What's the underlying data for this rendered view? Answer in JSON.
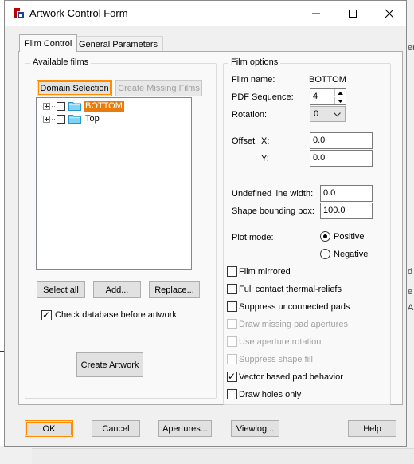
{
  "window": {
    "title": "Artwork Control Form"
  },
  "tabs": [
    {
      "label": "Film Control",
      "active": true
    },
    {
      "label": "General Parameters",
      "active": false
    }
  ],
  "available_films": {
    "group_label": "Available films",
    "domain_selection_label": "Domain Selection",
    "create_missing_label": "Create Missing Films",
    "films": [
      {
        "label": "BOTTOM",
        "selected": true,
        "checked": false
      },
      {
        "label": "Top",
        "selected": false,
        "checked": false
      }
    ],
    "select_all_label": "Select all",
    "add_label": "Add...",
    "replace_label": "Replace...",
    "check_db_label": "Check database before artwork",
    "check_db_checked": true,
    "create_artwork_label": "Create Artwork"
  },
  "film_options": {
    "group_label": "Film options",
    "film_name_label": "Film name:",
    "film_name_value": "BOTTOM",
    "pdf_sequence_label": "PDF Sequence:",
    "pdf_sequence_value": "4",
    "rotation_label": "Rotation:",
    "rotation_value": "0",
    "offset_label": "Offset",
    "x_label": "X:",
    "x_value": "0.0",
    "y_label": "Y:",
    "y_value": "0.0",
    "undefined_width_label": "Undefined line width:",
    "undefined_width_value": "0.0",
    "shape_bounding_label": "Shape bounding box:",
    "shape_bounding_value": "100.0",
    "plot_mode_label": "Plot mode:",
    "positive_label": "Positive",
    "negative_label": "Negative",
    "plot_mode_selected": "Positive",
    "checkboxes": [
      {
        "label": "Film mirrored",
        "checked": false,
        "enabled": true
      },
      {
        "label": "Full contact thermal-reliefs",
        "checked": false,
        "enabled": true
      },
      {
        "label": "Suppress unconnected pads",
        "checked": false,
        "enabled": true
      },
      {
        "label": "Draw missing pad apertures",
        "checked": false,
        "enabled": false
      },
      {
        "label": "Use aperture rotation",
        "checked": false,
        "enabled": false
      },
      {
        "label": "Suppress shape fill",
        "checked": false,
        "enabled": false
      },
      {
        "label": "Vector based pad behavior",
        "checked": true,
        "enabled": true
      },
      {
        "label": "Draw holes only",
        "checked": false,
        "enabled": true
      }
    ]
  },
  "footer": {
    "ok_label": "OK",
    "cancel_label": "Cancel",
    "apertures_label": "Apertures...",
    "viewlog_label": "Viewlog...",
    "help_label": "Help"
  },
  "background": {
    "glyph_1": "er",
    "glyph_2": "d",
    "glyph_3": "e",
    "glyph_4": "Al"
  },
  "colors": {
    "selection": "#e87d0d",
    "focus_border": "#ff8c00",
    "window_bg": "#f0f0f0"
  }
}
